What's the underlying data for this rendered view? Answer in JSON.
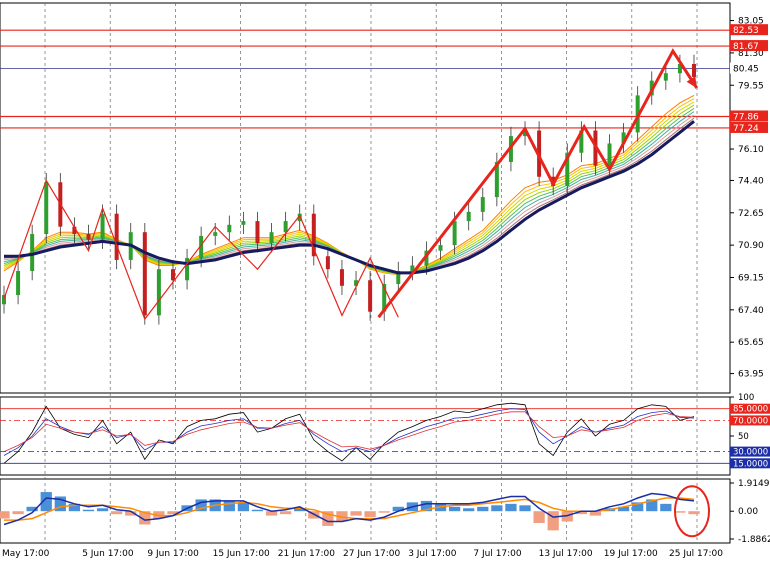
{
  "chart_data": {
    "type": "line",
    "x": [
      "May 17:00",
      "5 Jun 17:00",
      "9 Jun 17:00",
      "15 Jun 17:00",
      "21 Jun 17:00",
      "27 Jun 17:00",
      "3 Jul 17:00",
      "7 Jul 17:00",
      "13 Jul 17:00",
      "19 Jul 17:00",
      "25 Jul 17:00"
    ],
    "price_panel": {
      "y_ticks": [
        "83.05",
        "81.30",
        "79.55",
        "76.10",
        "74.40",
        "72.65",
        "70.90",
        "69.15",
        "67.40",
        "65.65",
        "63.95"
      ],
      "ylim": [
        62.9,
        84.0
      ],
      "levels": [
        {
          "label": "82.53",
          "value": 82.53,
          "color": "#e8251c"
        },
        {
          "label": "81.67",
          "value": 81.67,
          "color": "#e8251c"
        },
        {
          "label": "80.45",
          "value": 80.45,
          "color": "#34348c"
        },
        {
          "label": "77.86",
          "value": 77.86,
          "color": "#e8251c"
        },
        {
          "label": "77.24",
          "value": 77.24,
          "color": "#e8251c"
        }
      ],
      "close": [
        68.2,
        69.5,
        71.5,
        74.3,
        71.9,
        71.5,
        71.2,
        72.6,
        70.1,
        71.6,
        67.1,
        69.6,
        69.0,
        70.2,
        71.4,
        71.6,
        72.0,
        72.2,
        71.0,
        71.6,
        72.2,
        72.6,
        70.3,
        69.6,
        68.7,
        69.0,
        67.3,
        68.8,
        69.5,
        69.8,
        70.6,
        70.9,
        72.2,
        72.7,
        73.5,
        75.4,
        76.8,
        77.1,
        74.6,
        74.1,
        75.9,
        77.1,
        75.2,
        76.4,
        77.0,
        79.0,
        79.8,
        80.2,
        80.7,
        80.0
      ],
      "ma_fast": [
        69.5,
        70.0,
        70.6,
        71.3,
        71.6,
        71.6,
        71.5,
        71.6,
        71.2,
        70.9,
        70.1,
        69.8,
        69.8,
        70.0,
        70.4,
        70.7,
        71.0,
        71.3,
        71.3,
        71.3,
        71.5,
        71.7,
        71.4,
        71.0,
        70.5,
        70.1,
        69.6,
        69.4,
        69.3,
        69.5,
        69.8,
        70.2,
        70.7,
        71.2,
        71.7,
        72.5,
        73.3,
        74.0,
        74.3,
        74.4,
        74.7,
        75.2,
        75.3,
        75.6,
        75.9,
        76.6,
        77.3,
        78.0,
        78.6,
        79.0
      ],
      "ma_slow": [
        70.3,
        70.3,
        70.4,
        70.6,
        70.8,
        70.9,
        71.0,
        71.1,
        71.0,
        70.9,
        70.5,
        70.2,
        70.0,
        69.9,
        70.0,
        70.1,
        70.3,
        70.5,
        70.6,
        70.7,
        70.8,
        70.9,
        70.9,
        70.7,
        70.4,
        70.1,
        69.8,
        69.6,
        69.4,
        69.4,
        69.5,
        69.7,
        69.9,
        70.2,
        70.6,
        71.1,
        71.7,
        72.3,
        72.8,
        73.2,
        73.6,
        74.0,
        74.3,
        74.6,
        74.9,
        75.3,
        75.8,
        76.4,
        77.0,
        77.6
      ]
    },
    "oscillator_panel": {
      "y_ticks": [
        "100",
        "85.0000",
        "70.0000",
        "50",
        "30.0000",
        "15.0000"
      ],
      "ylim": [
        0,
        100
      ],
      "levels": [
        {
          "label": "85.0000",
          "value": 85,
          "color": "#e8251c"
        },
        {
          "label": "70.0000",
          "value": 70,
          "color": "#e8251c"
        },
        {
          "label": "30.0000",
          "value": 30,
          "color": "#1c2ea8"
        },
        {
          "label": "15.0000",
          "value": 15,
          "color": "#1c2ea8"
        }
      ],
      "series": [
        {
          "values": [
            15,
            30,
            55,
            88,
            60,
            52,
            48,
            70,
            40,
            55,
            20,
            45,
            40,
            62,
            70,
            72,
            78,
            80,
            55,
            60,
            72,
            78,
            45,
            30,
            18,
            35,
            20,
            40,
            55,
            62,
            70,
            75,
            82,
            80,
            85,
            90,
            92,
            90,
            40,
            25,
            55,
            72,
            50,
            65,
            70,
            85,
            90,
            88,
            70,
            75
          ]
        },
        {
          "values": [
            25,
            35,
            50,
            72,
            62,
            55,
            52,
            62,
            48,
            52,
            32,
            42,
            42,
            55,
            63,
            66,
            70,
            72,
            60,
            60,
            66,
            70,
            52,
            40,
            30,
            35,
            30,
            38,
            48,
            55,
            62,
            67,
            73,
            74,
            78,
            82,
            85,
            84,
            55,
            40,
            50,
            62,
            55,
            60,
            64,
            75,
            80,
            82,
            74,
            73
          ]
        },
        {
          "values": [
            30,
            38,
            48,
            65,
            60,
            55,
            53,
            58,
            50,
            52,
            38,
            42,
            43,
            52,
            58,
            62,
            66,
            68,
            61,
            60,
            64,
            67,
            55,
            45,
            36,
            37,
            33,
            38,
            45,
            51,
            57,
            62,
            68,
            70,
            74,
            78,
            81,
            81,
            62,
            48,
            50,
            58,
            55,
            58,
            61,
            70,
            76,
            79,
            75,
            74
          ]
        }
      ]
    },
    "macd_panel": {
      "y_ticks": [
        "1.9149",
        "0.00",
        "-1.8862"
      ],
      "ylim": [
        -1.8862,
        1.9149
      ],
      "histogram": [
        -0.5,
        -0.2,
        0.3,
        1.3,
        1.0,
        0.5,
        0.1,
        0.2,
        -0.2,
        -0.3,
        -0.9,
        -0.5,
        -0.2,
        0.4,
        0.8,
        0.8,
        0.7,
        0.6,
        0.1,
        -0.3,
        -0.2,
        0.2,
        -0.5,
        -1.0,
        -0.7,
        -0.3,
        -0.4,
        -0.1,
        0.3,
        0.6,
        0.7,
        0.5,
        0.3,
        0.2,
        0.3,
        0.4,
        0.5,
        0.4,
        -0.8,
        -1.3,
        -0.7,
        -0.2,
        -0.3,
        0.2,
        0.3,
        0.6,
        0.8,
        0.5,
        -0.1,
        -0.2
      ],
      "macd": [
        -0.9,
        -0.6,
        -0.1,
        0.9,
        0.8,
        0.5,
        0.3,
        0.4,
        0.1,
        0.0,
        -0.6,
        -0.5,
        -0.3,
        0.2,
        0.6,
        0.7,
        0.7,
        0.7,
        0.3,
        0.0,
        0.1,
        0.3,
        -0.2,
        -0.7,
        -0.7,
        -0.5,
        -0.6,
        -0.4,
        0.0,
        0.3,
        0.5,
        0.5,
        0.5,
        0.5,
        0.6,
        0.8,
        1.0,
        1.0,
        0.2,
        -0.4,
        -0.3,
        0.0,
        0.0,
        0.3,
        0.5,
        0.9,
        1.2,
        1.1,
        0.8,
        0.7
      ],
      "signal": [
        -0.6,
        -0.6,
        -0.5,
        -0.1,
        0.3,
        0.4,
        0.4,
        0.4,
        0.3,
        0.2,
        -0.1,
        -0.3,
        -0.3,
        -0.1,
        0.2,
        0.4,
        0.5,
        0.6,
        0.5,
        0.3,
        0.2,
        0.2,
        0.1,
        -0.2,
        -0.4,
        -0.5,
        -0.5,
        -0.5,
        -0.3,
        -0.1,
        0.1,
        0.3,
        0.4,
        0.4,
        0.5,
        0.6,
        0.7,
        0.8,
        0.6,
        0.2,
        0.0,
        0.0,
        0.0,
        0.1,
        0.3,
        0.5,
        0.7,
        0.9,
        0.9,
        0.8
      ]
    },
    "annotations": {
      "zigzag_color": "#e8251c",
      "circle_color": "#e8251c"
    }
  }
}
